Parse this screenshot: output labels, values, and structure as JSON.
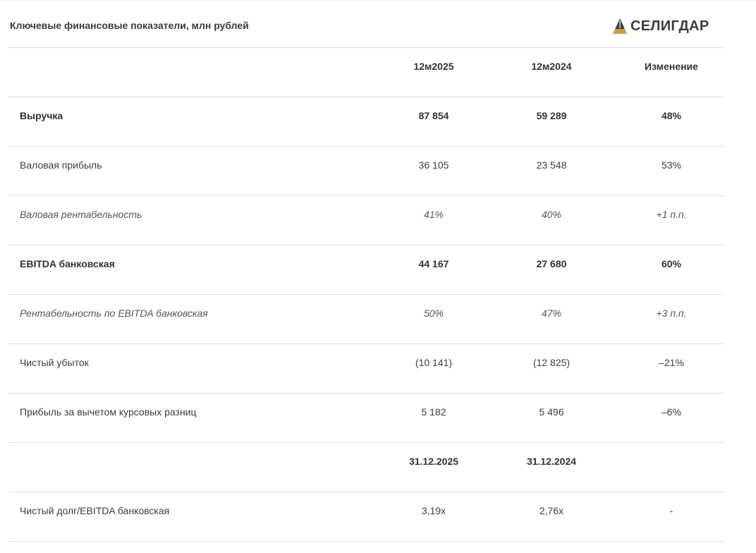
{
  "title": "Ключевые финансовые показатели, млн рублей",
  "logo": {
    "text": "СЕЛИГДАР",
    "icon": "seligdar-triangle-icon",
    "colors": {
      "dark": "#3d3d3d",
      "gold": "#c9a04a"
    }
  },
  "table": {
    "header": {
      "label": "",
      "col_a": "12м2025",
      "col_b": "12м2024",
      "col_c": "Изменение"
    },
    "rows": [
      {
        "label": "Выручка",
        "a": "87 854",
        "b": "59 289",
        "c": "48%"
      },
      {
        "label": "Валовая прибыль",
        "a": "36 105",
        "b": "23 548",
        "c": "53%"
      },
      {
        "label": "Валовая рентабельность",
        "a": "41%",
        "b": "40%",
        "c": "+1 п.п."
      },
      {
        "label": "EBITDA банковская",
        "a": "44 167",
        "b": "27 680",
        "c": "60%"
      },
      {
        "label": "Рентабельность по EBITDA банковская",
        "a": "50%",
        "b": "47%",
        "c": "+3 п.п."
      },
      {
        "label": "Чистый убыток",
        "a": "(10 141)",
        "b": "(12 825)",
        "c": "–21%"
      },
      {
        "label": "Прибыль за вычетом курсовых разниц",
        "a": "5 182",
        "b": "5 496",
        "c": "–6%"
      }
    ],
    "header2": {
      "label": "",
      "col_a": "31.12.2025",
      "col_b": "31.12.2024",
      "col_c": ""
    },
    "last_row": {
      "label": "Чистый долг/EBITDA банковская",
      "a": "3,19x",
      "b": "2,76x",
      "c": "-"
    }
  }
}
